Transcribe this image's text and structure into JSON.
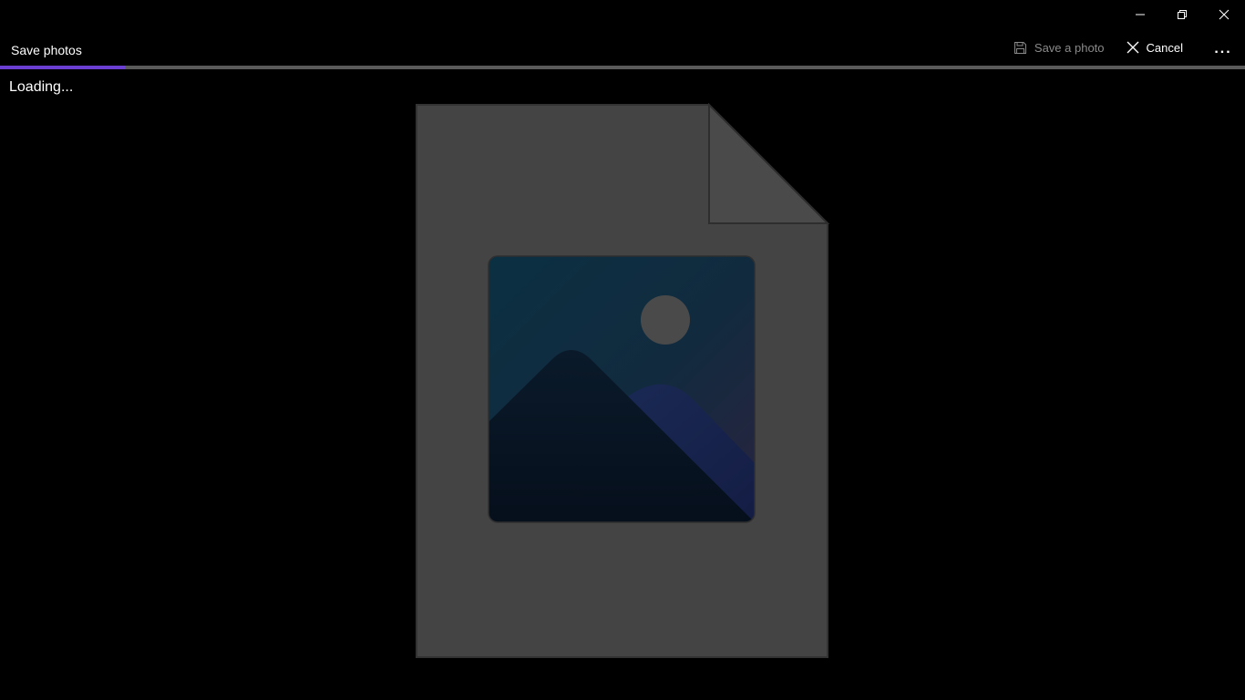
{
  "window": {
    "caption_buttons": {
      "minimize_icon": "minimize-icon",
      "restore_icon": "restore-icon",
      "close_icon": "close-icon"
    }
  },
  "header": {
    "title": "Save photos"
  },
  "command_bar": {
    "save_label": "Save a photo",
    "save_icon": "floppy-disk-icon",
    "save_enabled": false,
    "cancel_label": "Cancel",
    "cancel_icon": "close-icon",
    "more_label": "..."
  },
  "progress": {
    "value_fraction": 0.1,
    "color": "#6b3fd1",
    "track_color": "#5a5a5a"
  },
  "status": {
    "loading_text": "Loading..."
  },
  "preview": {
    "icon": "image-file-placeholder-icon"
  }
}
